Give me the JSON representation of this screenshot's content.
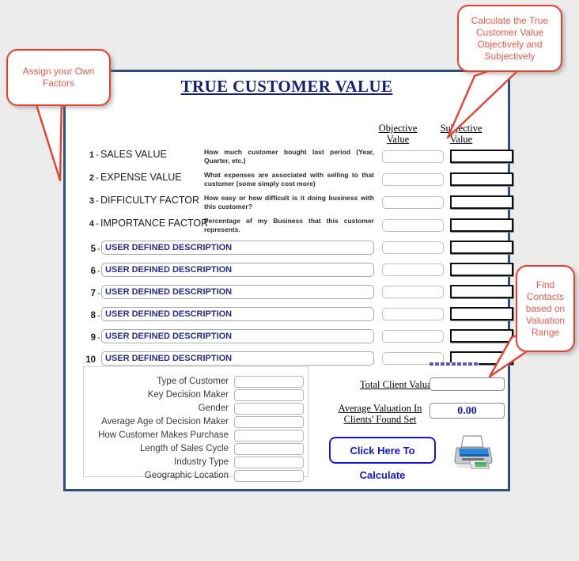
{
  "page": {
    "background_color": "#ececec",
    "panel_border_color": "#2d5080",
    "accent_blue": "#151f7a",
    "callout_border_color": "#e8402f",
    "callout_text_color": "#f05a4a",
    "button_blue": "#1616d8"
  },
  "form": {
    "title": "TRUE CUSTOMER VALUE",
    "headers": {
      "objective_line1": "Objective",
      "objective_line2": "Value",
      "subjective_line1": "Subjective",
      "subjective_line2": "Value"
    },
    "fixed_rows": [
      {
        "number": "1",
        "dash": "-",
        "label": "SALES VALUE",
        "description": "How much   customer bought last period (Year, Quarter, etc.)"
      },
      {
        "number": "2",
        "dash": "-",
        "label": "EXPENSE VALUE",
        "description": "What expenses are associated with selling to that customer (some simply cost more)"
      },
      {
        "number": "3",
        "dash": "-",
        "label": "DIFFICULTY FACTOR",
        "description": "How easy or how difficult is it doing business with this customer?"
      },
      {
        "number": "4",
        "dash": "-",
        "label": "IMPORTANCE FACTOR",
        "description": "Percentage of my Business that this customer represents."
      }
    ],
    "user_rows": [
      {
        "number": "5",
        "dash": "-",
        "description": "USER DEFINED DESCRIPTION"
      },
      {
        "number": "6",
        "dash": "-",
        "description": "USER DEFINED DESCRIPTION"
      },
      {
        "number": "7",
        "dash": "-",
        "description": "USER DEFINED DESCRIPTION"
      },
      {
        "number": "8",
        "dash": "-",
        "description": "USER DEFINED DESCRIPTION"
      },
      {
        "number": "9",
        "dash": "-",
        "description": "USER DEFINED DESCRIPTION"
      },
      {
        "number": "10",
        "dash": "",
        "description": "USER DEFINED DESCRIPTION"
      }
    ],
    "row10_extra_dash": "-",
    "demographics": [
      {
        "label": "Type of Customer",
        "value": ""
      },
      {
        "label": "Key Decision Maker",
        "value": ""
      },
      {
        "label": "Gender",
        "value": ""
      },
      {
        "label": "Average Age of Decision Maker",
        "value": ""
      },
      {
        "label": "How Customer Makes Purchase",
        "value": ""
      },
      {
        "label": "Length of Sales Cycle",
        "value": ""
      },
      {
        "label": "Industry Type",
        "value": ""
      },
      {
        "label": "Geographic Location",
        "value": ""
      }
    ],
    "totals": {
      "total_label": "Total Client Valuation",
      "total_value": "",
      "average_label_line1": "Average  Valuation  In",
      "average_label_line2": "Clients' Found Set",
      "average_value": "0.00"
    },
    "calculate_button": "Click Here To Calculate",
    "printer_icon": "printer-icon"
  },
  "callouts": {
    "assign": {
      "lines": [
        "Assign your Own",
        "Factors"
      ],
      "text": "Assign your Own Factors"
    },
    "calculate": {
      "lines": [
        "Calculate the",
        "True Customer",
        "Value Objectively",
        "and Subjectively"
      ],
      "text": "Calculate the True Customer Value Objectively and Subjectively"
    },
    "find": {
      "lines": [
        "Find",
        "Contacts",
        "based on",
        "Valuation",
        "Range"
      ],
      "text": "Find Contacts based on Valuation Range"
    }
  }
}
